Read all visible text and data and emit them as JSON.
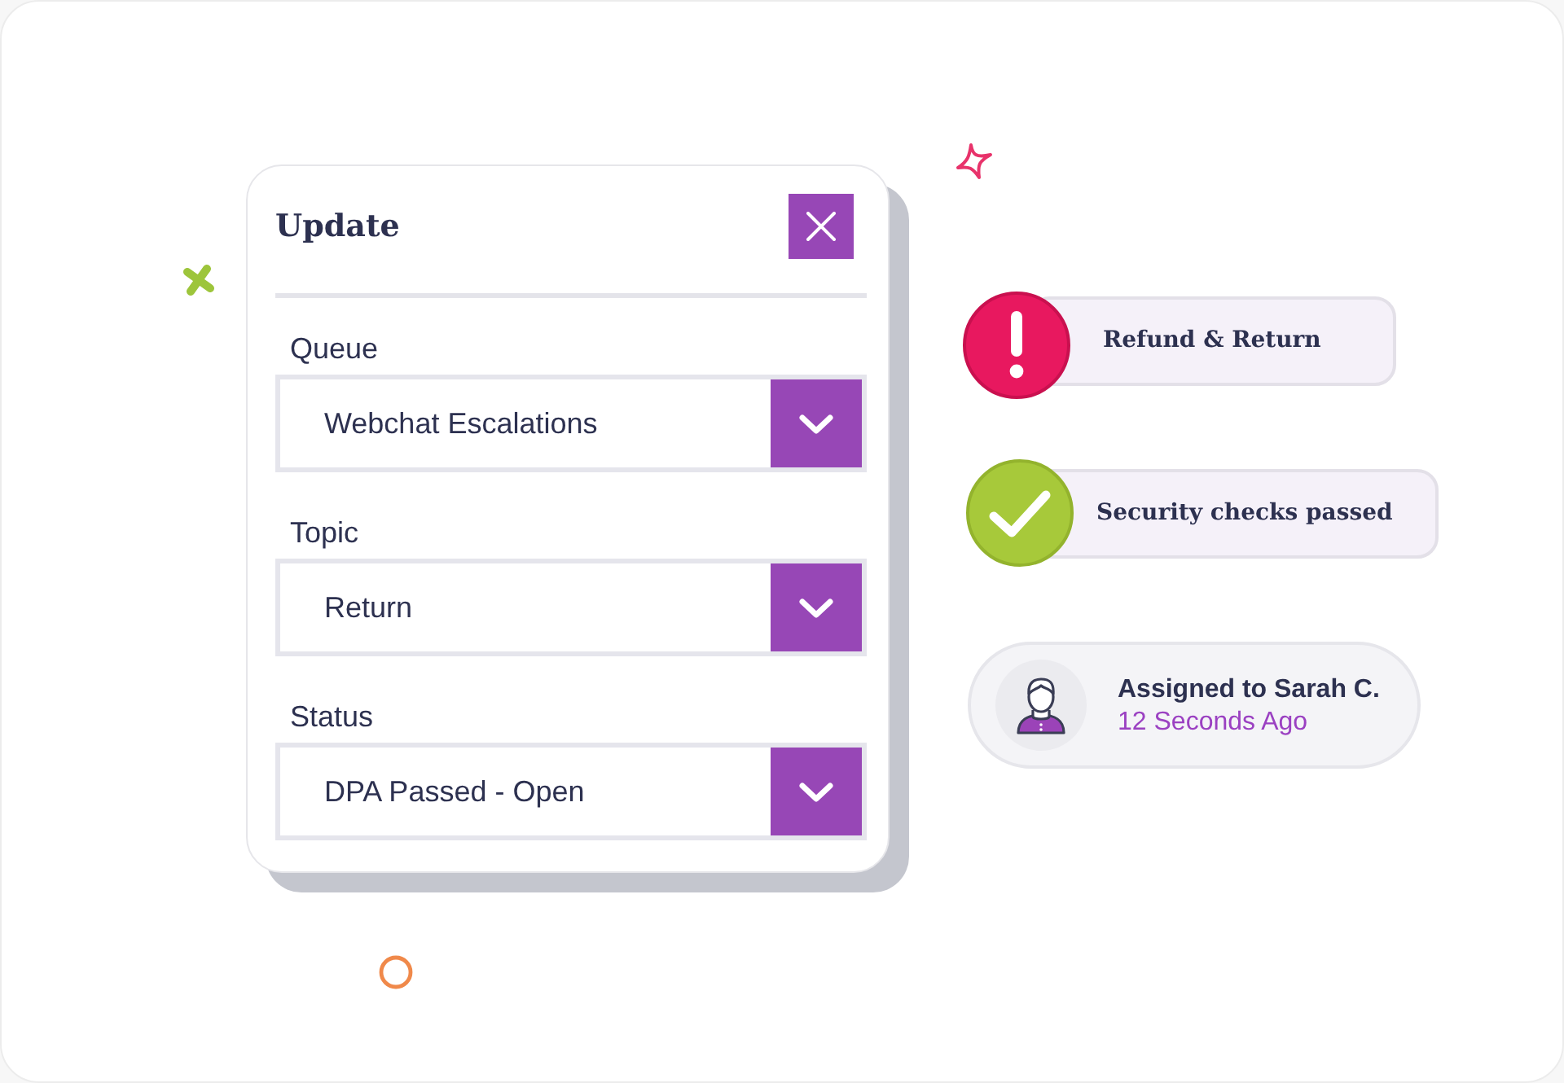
{
  "dialog": {
    "title": "Update",
    "fields": [
      {
        "label": "Queue",
        "value": "Webchat Escalations"
      },
      {
        "label": "Topic",
        "value": "Return"
      },
      {
        "label": "Status",
        "value": "DPA Passed - Open"
      }
    ]
  },
  "notifications": [
    {
      "kind": "alert",
      "text": "Refund & Return"
    },
    {
      "kind": "success",
      "text": "Security checks passed"
    }
  ],
  "assignment": {
    "title": "Assigned to Sarah C.",
    "time": "12 Seconds Ago"
  }
}
